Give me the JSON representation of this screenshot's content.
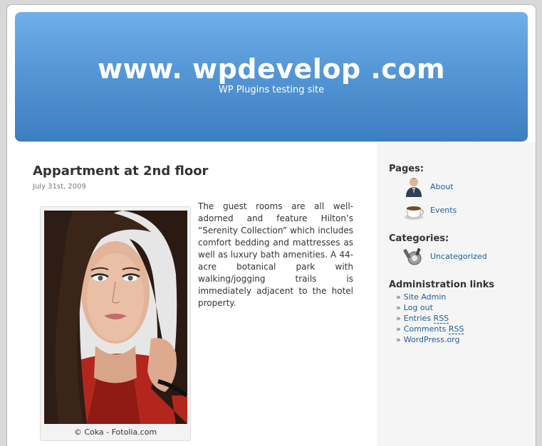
{
  "header": {
    "title": "www. wpdevelop .com",
    "description": "WP Plugins testing site"
  },
  "post": {
    "title": "Appartment at 2nd floor",
    "date": "July 31st, 2009",
    "image_caption": "© Coka - Fotolia.com",
    "body": "The guest rooms are all well-adorned and feature Hilton’s “Serenity Collection” which includes comfort bedding and mattresses as well as luxury bath amenities. A 44-acre botanical park with walking/jogging trails is immediately adjacent to the hotel property."
  },
  "sidebar": {
    "pages_heading": "Pages:",
    "pages": [
      {
        "label": "About",
        "icon": "user-icon"
      },
      {
        "label": "Events",
        "icon": "coffee-cup-icon"
      }
    ],
    "categories_heading": "Categories:",
    "categories": [
      {
        "label": "Uncategorized",
        "icon": "tools-icon"
      }
    ],
    "admin_heading": "Administration links",
    "admin_links": [
      {
        "prefix": "Site Admin",
        "abbr": ""
      },
      {
        "prefix": "Log out",
        "abbr": ""
      },
      {
        "prefix": "Entries ",
        "abbr": "RSS"
      },
      {
        "prefix": "Comments ",
        "abbr": "RSS"
      },
      {
        "prefix": "WordPress.org",
        "abbr": ""
      }
    ]
  },
  "colors": {
    "header_top": "#6fb0ea",
    "header_bottom": "#3d7ec0",
    "link": "#1e5d9a",
    "sidebar_bg": "#f5f5f5"
  }
}
